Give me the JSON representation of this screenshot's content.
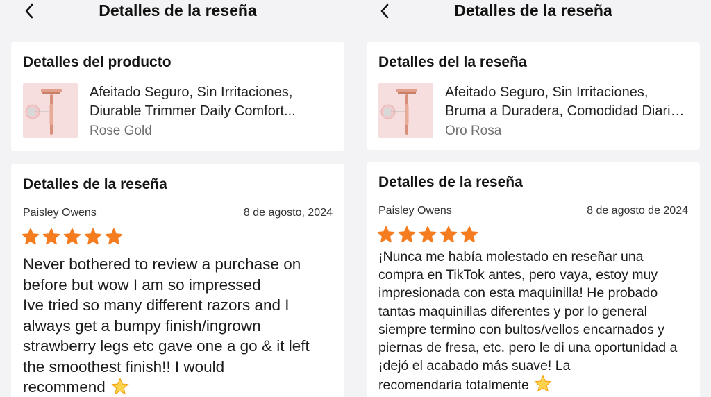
{
  "left": {
    "header_title": "Detalles de la reseña",
    "product_card": {
      "title": "Detalles del producto",
      "name_line1": "Afeitado Seguro, Sin Irritaciones,",
      "name_line2": "Diurable Trimmer Daily Comfort...",
      "variant": "Rose Gold"
    },
    "review_card": {
      "title": "Detalles de la reseña",
      "reviewer": "Paisley Owens",
      "date": "8 de agosto, 2024",
      "rating": 5,
      "lines": [
        "Never bothered to review a purchase on",
        "before but wow I am so impressed",
        "Ive tried so many different razors and I",
        "always get a bumpy finish/ingrown",
        "strawberry legs etc gave one a go & it left",
        "the smoothest finish!! I would",
        "recommend"
      ]
    }
  },
  "right": {
    "header_title": "Detalles de la reseña",
    "product_card": {
      "title": "Detalles del la reseña",
      "name_line1": "Afeitado Seguro, Sin Irritaciones,",
      "name_line2": "Bruma a  Duradera, Comodidad Diaria...",
      "variant": "Oro Rosa"
    },
    "review_card": {
      "title": "Detalles de la reseña",
      "reviewer": "Paisley Owens",
      "date": "8 de agosto de 2024",
      "rating": 5,
      "lines": [
        "¡Nunca me había molestado en reseñar una",
        "compra en TikTok antes, pero vaya, estoy muy",
        "impresionada con esta maquinilla! He probado",
        "tantas maquinillas diferentes y por lo general",
        "siempre termino con bultos/vellos encarnados y",
        "piernas de fresa, etc. pero le di una oportunidad a",
        "¡dejó el acabado más suave! La",
        "recomendaría totalmente"
      ]
    }
  },
  "icons": {
    "back": "chevron-left-icon",
    "star": "star-icon",
    "emoji": "glowing-star-emoji"
  },
  "colors": {
    "star": "#f57c1f",
    "background": "#f3f3f5",
    "card": "#ffffff",
    "thumb_bg": "#f7dede",
    "razor": "#d9907a"
  }
}
